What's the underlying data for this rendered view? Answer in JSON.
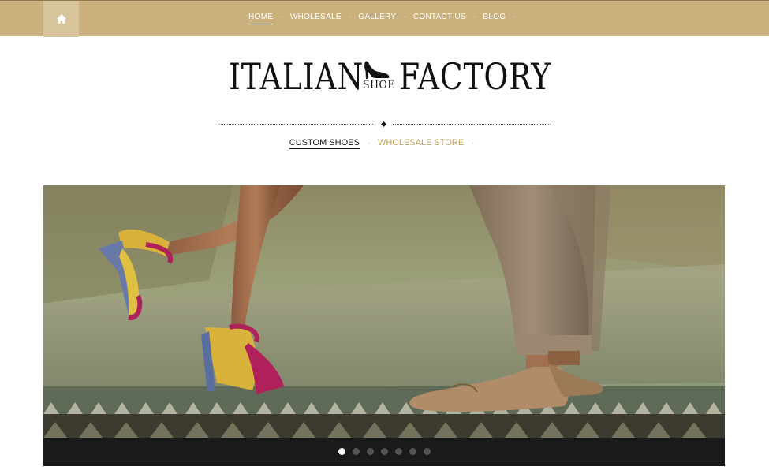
{
  "topnav": {
    "home_icon": "house-icon",
    "items": [
      {
        "label": "HOME",
        "active": true
      },
      {
        "label": "WHOLESALE",
        "active": false
      },
      {
        "label": "GALLERY",
        "active": false
      },
      {
        "label": "CONTACT US",
        "active": false
      },
      {
        "label": "BLOG",
        "active": false
      }
    ],
    "separator": "·"
  },
  "logo": {
    "word_left": "ITALIAN",
    "word_right": "FACTORY",
    "word_small": "SHOE",
    "icon": "high-heel-shoe-icon"
  },
  "subnav": {
    "items": [
      {
        "label": "CUSTOM SHOES",
        "active": true
      },
      {
        "label": "WHOLESALE STORE",
        "active": false
      }
    ],
    "separator": "·"
  },
  "slider": {
    "image": "photo of a woman's legs in colorful high-heel sandals and a man's legs in khaki trousers and suede loafers beside a tiled fountain",
    "slide_count": 7,
    "active_slide": 1
  },
  "colors": {
    "topbar": "#c9b07c",
    "home_button": "#d9c59c",
    "gold_link": "#c2a35a",
    "slider_bar": "#1a1a1a"
  }
}
